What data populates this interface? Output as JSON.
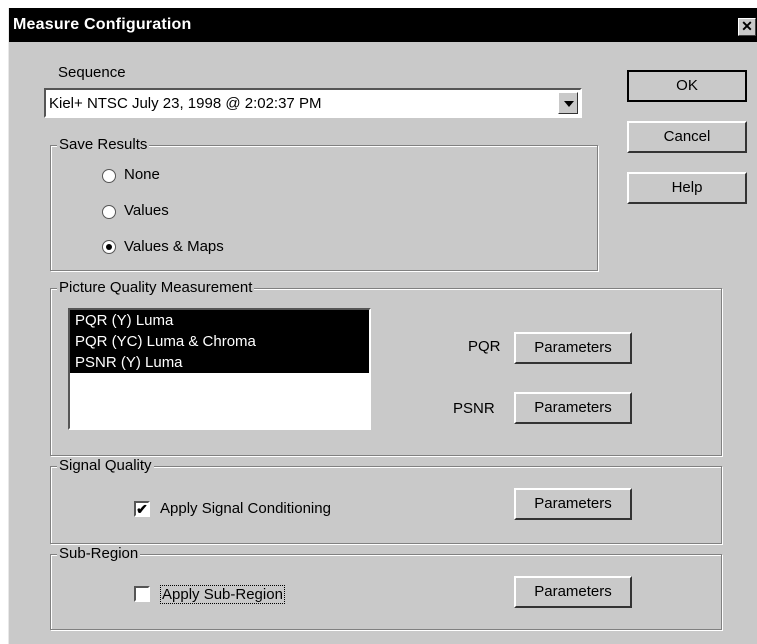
{
  "window": {
    "title": "Measure Configuration",
    "close_glyph": "✕"
  },
  "sequence": {
    "label": "Sequence",
    "selected": "Kiel+ NTSC July 23, 1998 @ 2:02:37 PM"
  },
  "buttons": {
    "ok": "OK",
    "cancel": "Cancel",
    "help": "Help"
  },
  "save_results": {
    "legend": "Save Results",
    "options": [
      "None",
      "Values",
      "Values & Maps"
    ],
    "selected_index": 2
  },
  "picture_quality": {
    "legend": "Picture Quality Measurement",
    "items": [
      "PQR (Y) Luma",
      "PQR (YC) Luma & Chroma",
      "PSNR (Y) Luma"
    ],
    "pqr_label": "PQR",
    "psnr_label": "PSNR",
    "parameters_label": "Parameters"
  },
  "signal_quality": {
    "legend": "Signal Quality",
    "checkbox_label": "Apply Signal Conditioning",
    "checked": true,
    "check_glyph": "✔",
    "parameters_label": "Parameters"
  },
  "sub_region": {
    "legend": "Sub-Region",
    "checkbox_label": "Apply Sub-Region",
    "checked": false,
    "parameters_label": "Parameters"
  },
  "colors": {
    "dialog_bg": "#c9c9c9",
    "title_bg": "#000000",
    "selection_bg": "#000000"
  }
}
